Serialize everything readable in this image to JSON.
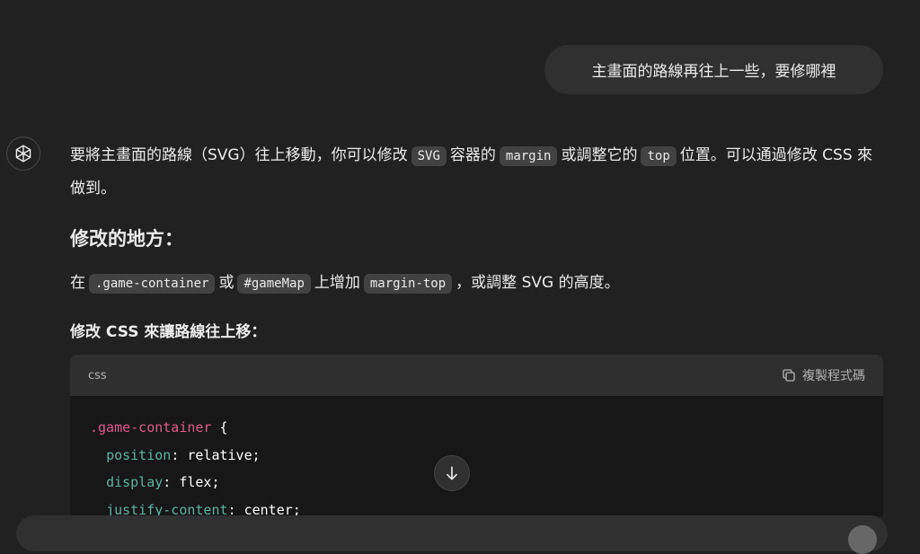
{
  "user_message": "主畫面的路線再往上一些，要修哪裡",
  "assistant": {
    "para1": {
      "t1": "要將主畫面的路線（SVG）往上移動，你可以修改",
      "c1": "SVG",
      "t2": "容器的",
      "c2": "margin",
      "t3": "或調整它的",
      "c3": "top",
      "t4": "位置。可以通過修改 CSS 來做到。"
    },
    "heading": "修改的地方：",
    "para2": {
      "t1": "在",
      "c1": ".game-container",
      "t2": "或",
      "c2": "#gameMap",
      "t3": "上增加",
      "c3": "margin-top",
      "t4": "，或調整 SVG 的高度。"
    },
    "subheading": "修改 CSS 來讓路線往上移：",
    "code_block": {
      "language": "css",
      "copy_label": "複製程式碼",
      "selector": ".game-container",
      "open_brace": "{",
      "lines": [
        {
          "prop": "position",
          "value": "relative;"
        },
        {
          "prop": "display",
          "value": "flex;"
        },
        {
          "prop": "justify-content",
          "value": "center;"
        }
      ]
    }
  },
  "icons": {
    "avatar": "openai-logo-icon",
    "copy": "copy-icon",
    "scroll": "arrow-down-icon"
  }
}
